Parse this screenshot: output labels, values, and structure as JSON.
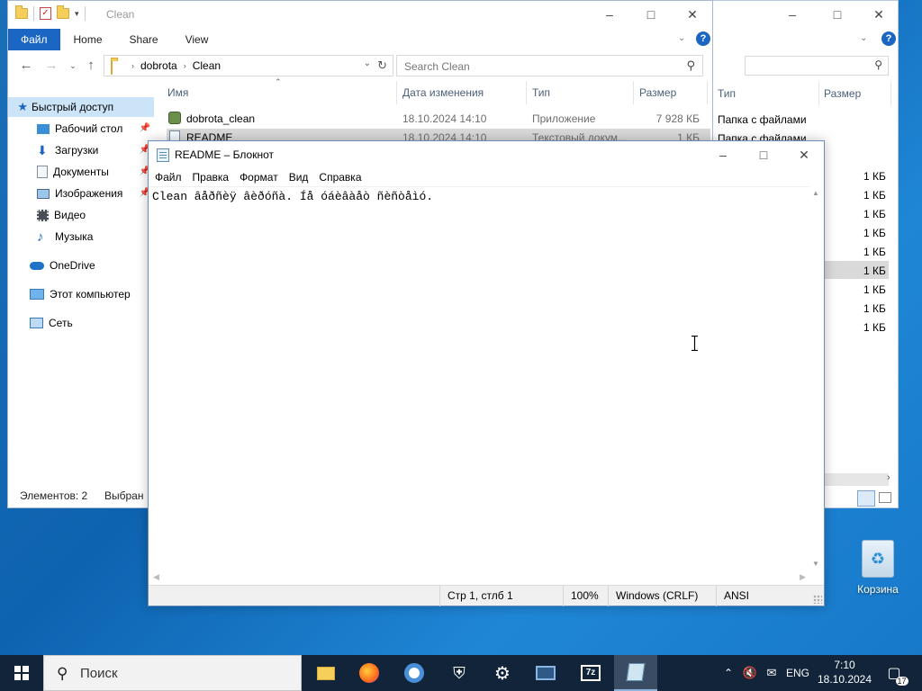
{
  "explorer": {
    "title": "Clean",
    "ribbon_tabs": [
      "Файл",
      "Home",
      "Share",
      "View"
    ],
    "address": [
      "dobrota",
      "Clean"
    ],
    "search_placeholder": "Search Clean",
    "nav_items": [
      {
        "label": "Быстрый доступ",
        "icon": "star-icon",
        "pinned": false
      },
      {
        "label": "Рабочий стол",
        "icon": "desktop-icon",
        "pinned": true
      },
      {
        "label": "Загрузки",
        "icon": "download-icon",
        "pinned": true
      },
      {
        "label": "Документы",
        "icon": "documents-icon",
        "pinned": true
      },
      {
        "label": "Изображения",
        "icon": "pictures-icon",
        "pinned": true
      },
      {
        "label": "Видео",
        "icon": "video-icon",
        "pinned": false
      },
      {
        "label": "Музыка",
        "icon": "music-icon",
        "pinned": false
      },
      {
        "label": "OneDrive",
        "icon": "onedrive-icon",
        "pinned": false
      },
      {
        "label": "Этот компьютер",
        "icon": "computer-icon",
        "pinned": false
      },
      {
        "label": "Сеть",
        "icon": "network-icon",
        "pinned": false
      }
    ],
    "columns": [
      "Имя",
      "Дата изменения",
      "Тип",
      "Размер"
    ],
    "files": [
      {
        "name": "dobrota_clean",
        "date": "18.10.2024 14:10",
        "type": "Приложение",
        "size": "7 928 КБ"
      },
      {
        "name": "README",
        "date": "18.10.2024 14:10",
        "type": "Текстовый докум...",
        "size": "1 КБ"
      }
    ],
    "status_count": "Элементов: 2",
    "status_selected": "Выбран"
  },
  "explorer2": {
    "columns": [
      "Тип",
      "Размер"
    ],
    "rows": [
      {
        "type": "Папка с файлами",
        "size": ""
      },
      {
        "type": "Папка с файлами",
        "size": ""
      },
      {
        "type": "",
        "size": "1 КБ"
      },
      {
        "type": "",
        "size": "1 КБ"
      },
      {
        "type": "",
        "size": "1 КБ"
      },
      {
        "type": "",
        "size": "1 КБ"
      },
      {
        "type": "",
        "size": "1 КБ"
      },
      {
        "type": "",
        "size": "1 КБ"
      },
      {
        "type": "",
        "size": "1 КБ"
      },
      {
        "type": "",
        "size": "1 КБ"
      },
      {
        "type": "",
        "size": "1 КБ"
      }
    ]
  },
  "notepad": {
    "title": "README – Блокнот",
    "menu": [
      "Файл",
      "Правка",
      "Формат",
      "Вид",
      "Справка"
    ],
    "content": "Clean âåðñèÿ âèðóñà. Íå óáèâàåò ñèñòåìó.",
    "status": {
      "position": "Стр 1, стлб 1",
      "zoom": "100%",
      "line_endings": "Windows (CRLF)",
      "encoding": "ANSI"
    }
  },
  "desktop": {
    "recycle_bin": "Корзина"
  },
  "taskbar": {
    "search_text": "Поиск",
    "apps": [
      "file-explorer-icon",
      "firefox-icon",
      "chrome-icon",
      "security-icon",
      "settings-icon",
      "network-app-icon",
      "7zip-icon",
      "notepad-icon"
    ],
    "language": "ENG",
    "time": "7:10",
    "date": "18.10.2024",
    "notifications": "17"
  }
}
